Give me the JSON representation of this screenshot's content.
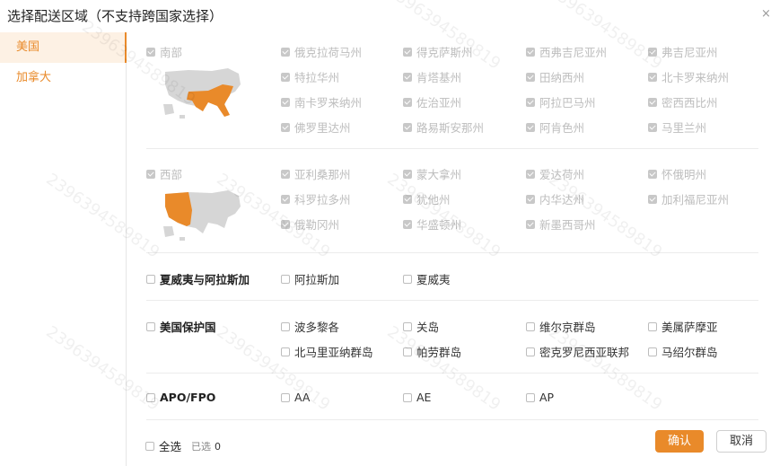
{
  "dialog": {
    "title": "选择配送区域（不支持跨国家选择）",
    "close": "×"
  },
  "sidebar": {
    "items": [
      {
        "label": "美国"
      },
      {
        "label": "加拿大"
      }
    ]
  },
  "regions": {
    "south": {
      "label": "南部",
      "states": [
        "俄克拉荷马州",
        "得克萨斯州",
        "西弗吉尼亚州",
        "弗吉尼亚州",
        "特拉华州",
        "肯塔基州",
        "田纳西州",
        "北卡罗来纳州",
        "南卡罗来纳州",
        "佐治亚州",
        "阿拉巴马州",
        "密西西比州",
        "佛罗里达州",
        "路易斯安那州",
        "阿肯色州",
        "马里兰州"
      ]
    },
    "west": {
      "label": "西部",
      "states": [
        "亚利桑那州",
        "蒙大拿州",
        "爱达荷州",
        "怀俄明州",
        "科罗拉多州",
        "犹他州",
        "内华达州",
        "加利福尼亚州",
        "俄勒冈州",
        "华盛顿州",
        "新墨西哥州"
      ]
    },
    "hawaii_alaska": {
      "label": "夏威夷与阿拉斯加",
      "states": [
        "阿拉斯加",
        "夏威夷"
      ]
    },
    "territories": {
      "label": "美国保护国",
      "states": [
        "波多黎各",
        "关岛",
        "维尔京群岛",
        "美属萨摩亚",
        "北马里亚纳群岛",
        "帕劳群岛",
        "密克罗尼西亚联邦",
        "马绍尔群岛"
      ]
    },
    "apo": {
      "label": "APO/FPO",
      "states": [
        "AA",
        "AE",
        "AP"
      ]
    }
  },
  "footer": {
    "select_all": "全选",
    "selected_label": "已选",
    "selected_count": "0",
    "confirm": "确认",
    "cancel": "取消"
  },
  "colors": {
    "accent": "#e98a2a",
    "map_gray": "#d6d6d6"
  },
  "watermark": "2396394589819"
}
